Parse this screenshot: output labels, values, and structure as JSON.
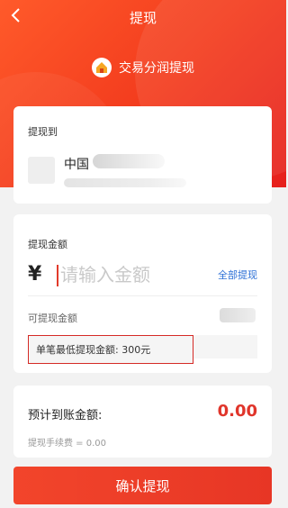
{
  "header": {
    "title": "提现",
    "back_icon": "chevron-left-icon",
    "brand_text": "交易分润提现",
    "brand_icon": "house-icon",
    "colors": {
      "start": "#ff5a2a",
      "end": "#e61f1c"
    }
  },
  "withdraw_to": {
    "label": "提现到",
    "bank_name": "中国"
  },
  "amount": {
    "label": "提现金额",
    "currency": "¥",
    "placeholder": "请输入金额",
    "all_link": "全部提现",
    "available_label": "可提现金额",
    "min_notice": "单笔最低提现金额: 300元"
  },
  "estimate": {
    "label": "预计到账金额:",
    "value": "0.00",
    "fee": "提现手续费 = 0.00"
  },
  "confirm_label": "确认提现"
}
